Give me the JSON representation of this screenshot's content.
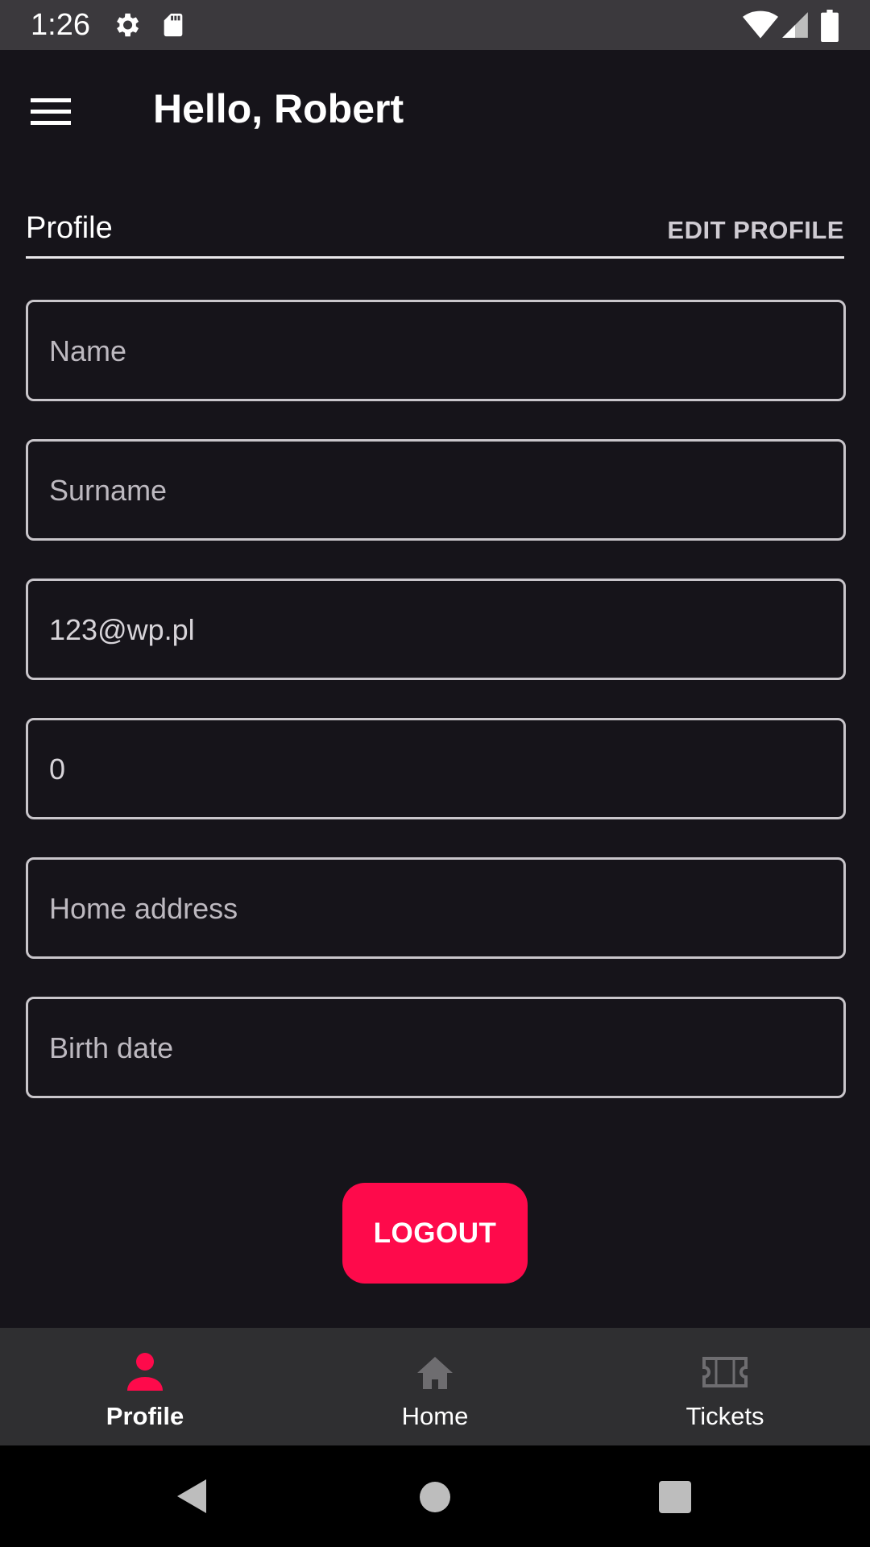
{
  "status_bar": {
    "time": "1:26",
    "icons": [
      "settings-icon",
      "sd-card-icon",
      "wifi-icon",
      "signal-icon",
      "battery-icon"
    ]
  },
  "app_bar": {
    "title": "Hello, Robert",
    "menu_icon": "hamburger-menu-icon"
  },
  "profile_section": {
    "title": "Profile",
    "edit_label": "EDIT PROFILE"
  },
  "fields": [
    {
      "placeholder": "Name",
      "value": ""
    },
    {
      "placeholder": "Surname",
      "value": ""
    },
    {
      "placeholder": "",
      "value": "123@wp.pl"
    },
    {
      "placeholder": "",
      "value": "0"
    },
    {
      "placeholder": "Home address",
      "value": ""
    },
    {
      "placeholder": "Birth date",
      "value": ""
    }
  ],
  "logout_label": "LOGOUT",
  "bottom_nav": {
    "items": [
      {
        "label": "Profile",
        "icon": "person-icon",
        "active": true
      },
      {
        "label": "Home",
        "icon": "home-icon",
        "active": false
      },
      {
        "label": "Tickets",
        "icon": "ticket-icon",
        "active": false
      }
    ]
  },
  "colors": {
    "background": "#16141a",
    "accent": "#fe0a4b",
    "nav_background": "#2f2f31",
    "status_bar": "#3b393d"
  }
}
